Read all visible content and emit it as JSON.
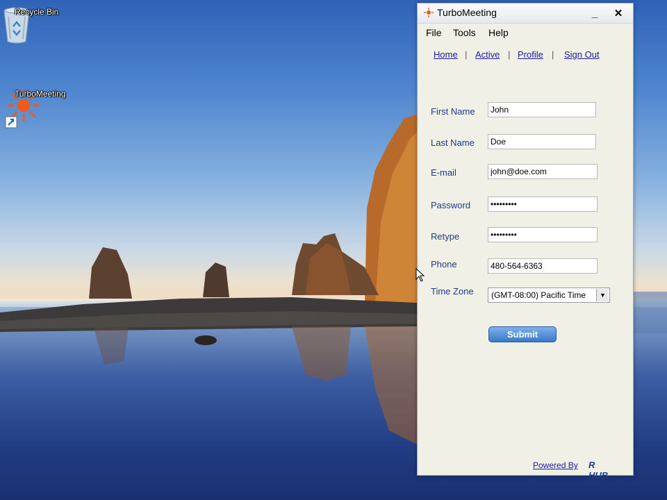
{
  "desktop": {
    "icons": [
      {
        "label": "Recycle Bin",
        "icon": "recycle-bin-icon"
      },
      {
        "label": "TurboMeeting",
        "icon": "turbomeeting-shortcut-icon"
      }
    ]
  },
  "window": {
    "title": "TurboMeeting",
    "controls": {
      "minimize": "_",
      "close": "✕"
    },
    "menu": [
      "File",
      "Tools",
      "Help"
    ],
    "nav": {
      "links": [
        "Home",
        "Active",
        "Profile",
        "Sign Out"
      ],
      "separator": "|"
    },
    "form": {
      "first_name": {
        "label": "First Name",
        "value": "John"
      },
      "last_name": {
        "label": "Last Name",
        "value": "Doe"
      },
      "email": {
        "label": "E-mail",
        "value": "john@doe.com"
      },
      "password": {
        "label": "Password",
        "value": "•••••••••"
      },
      "retype": {
        "label": "Retype",
        "value": "•••••••••"
      },
      "phone": {
        "label": "Phone",
        "value": "480-564-6363"
      },
      "time_zone": {
        "label": "Time Zone",
        "value": "(GMT-08:00) Pacific Time"
      },
      "submit_label": "Submit"
    },
    "footer": {
      "powered_by": "Powered By",
      "brand": "R HUB"
    }
  },
  "colors": {
    "accent": "#3a78c9",
    "link": "#1a1aa6",
    "label": "#1e3a8c",
    "window_bg": "#f0f0e7"
  }
}
